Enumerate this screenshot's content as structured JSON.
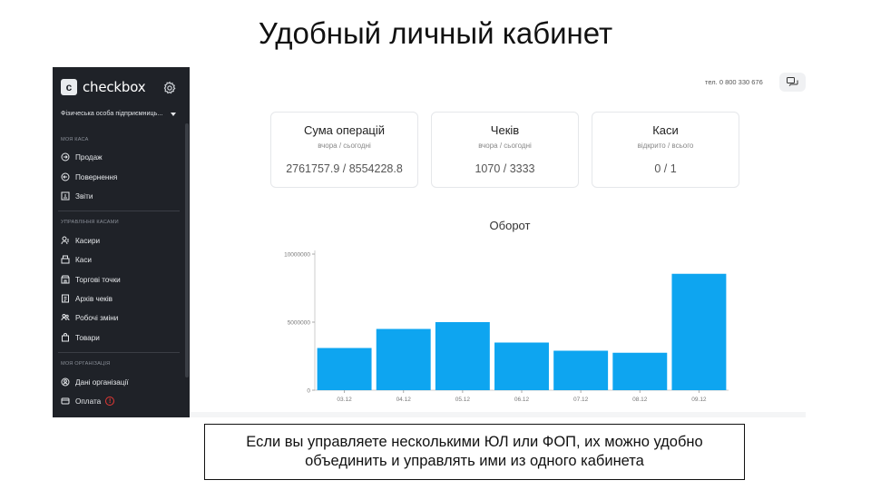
{
  "slide": {
    "title": "Удобный личный кабинет",
    "note": "Если вы управляете несколькими ЮЛ или ФОП, их можно удобно объединить и управлять ими из одного кабинета"
  },
  "app": {
    "logo_letter": "c",
    "logo_text": "checkbox",
    "entity": "Фізичеська особа підприємниць...",
    "phone": "тел. 0 800 330 676"
  },
  "sidebar": {
    "sections": [
      {
        "label": "МОЯ КАСА",
        "items": [
          {
            "label": "Продаж",
            "icon": "sale-icon"
          },
          {
            "label": "Повернення",
            "icon": "return-icon"
          },
          {
            "label": "Звіти",
            "icon": "reports-icon"
          }
        ]
      },
      {
        "label": "УПРАВЛІННЯ КАСАМИ",
        "items": [
          {
            "label": "Касири",
            "icon": "cashiers-icon"
          },
          {
            "label": "Каси",
            "icon": "registers-icon"
          },
          {
            "label": "Торгові точки",
            "icon": "stores-icon"
          },
          {
            "label": "Архів чеків",
            "icon": "archive-icon"
          },
          {
            "label": "Робочі зміни",
            "icon": "shifts-icon"
          },
          {
            "label": "Товари",
            "icon": "goods-icon"
          }
        ]
      },
      {
        "label": "МОЯ ОРГАНІЗАЦІЯ",
        "items": [
          {
            "label": "Дані організації",
            "icon": "org-data-icon"
          },
          {
            "label": "Оплата",
            "icon": "payment-icon",
            "alert": "!"
          }
        ]
      }
    ]
  },
  "cards": [
    {
      "title": "Сума операцій",
      "sub": "вчора / сьогодні",
      "value": "2761757.9 / 8554228.8"
    },
    {
      "title": "Чеків",
      "sub": "вчора / сьогодні",
      "value": "1070 / 3333"
    },
    {
      "title": "Каси",
      "sub": "відкрито / всього",
      "value": "0 / 1"
    }
  ],
  "colors": {
    "sidebar_bg": "#1f2228",
    "bar": "#0ea5f0",
    "alert": "#e53935"
  },
  "chart_data": {
    "type": "bar",
    "title": "Оборот",
    "categories": [
      "03.12",
      "04.12",
      "05.12",
      "06.12",
      "07.12",
      "08.12",
      "09.12"
    ],
    "values": [
      3100000,
      4500000,
      5000000,
      3500000,
      2900000,
      2750000,
      8550000
    ],
    "ylim": [
      0,
      10000000
    ],
    "yticks": [
      "0",
      "5000000",
      "10000000"
    ],
    "xlabel": "",
    "ylabel": "",
    "grid": false,
    "legend": "none"
  }
}
